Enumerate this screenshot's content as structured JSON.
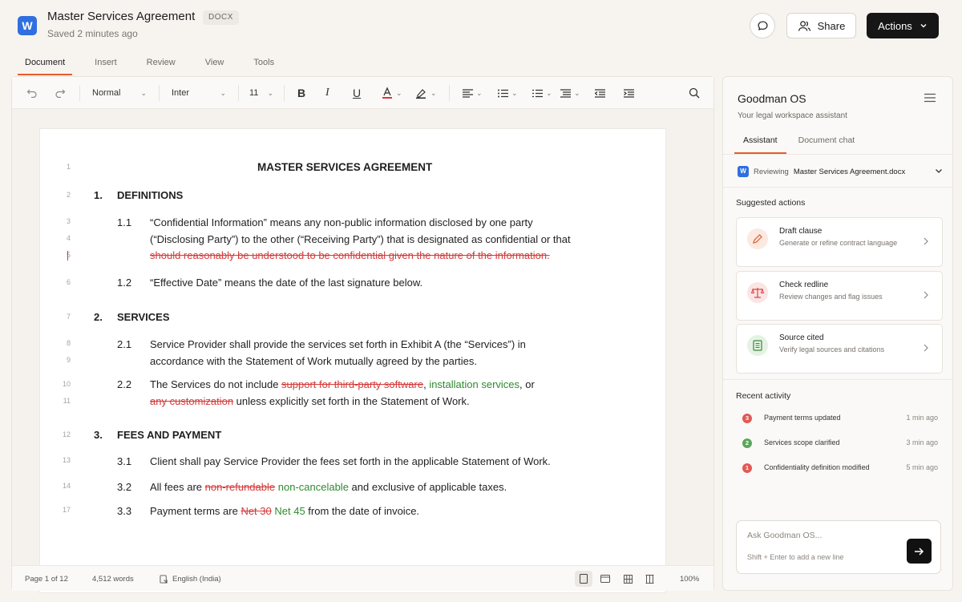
{
  "header": {
    "app_icon_letter": "W",
    "title": "Master Services Agreement",
    "badge": "DOCX",
    "saved": "Saved 2 minutes ago",
    "share_label": "Share",
    "actions_label": "Actions"
  },
  "menu": {
    "tabs": [
      "Document",
      "Insert",
      "Review",
      "View",
      "Tools"
    ]
  },
  "toolbar": {
    "style": "Normal",
    "font": "Inter",
    "size": "11"
  },
  "document": {
    "title": "MASTER SERVICES AGREEMENT",
    "line_numbers": [
      "1",
      "2",
      "3",
      "4",
      "5",
      "6",
      "7",
      "8",
      "9",
      "10",
      "11",
      "12",
      "13",
      "14",
      "17"
    ],
    "s1": {
      "num": "1.",
      "title": "DEFINITIONS"
    },
    "c11": {
      "num": "1.1",
      "l1": "“Confidential Information” means any non-public information disclosed by one party",
      "l2": "(“Disclosing Party”) to the other (“Receiving Party”) that is designated as confidential or that",
      "l3_del": "should reasonably be understood to be confidential given the nature of the information."
    },
    "c12": {
      "num": "1.2",
      "text": "“Effective Date” means the date of the last signature below."
    },
    "s2": {
      "num": "2.",
      "title": "SERVICES"
    },
    "c21": {
      "num": "2.1",
      "l1": "Service Provider shall provide the services set forth in Exhibit A (the “Services”) in",
      "l2": "accordance with the Statement of Work mutually agreed by the parties."
    },
    "c22": {
      "num": "2.2",
      "pre": "The Services do not include ",
      "del1": "support for third-party software",
      "comma": ", ",
      "ins1": "installation services",
      "post1": ", or",
      "del2": "any customization",
      "post2": " unless explicitly set forth in the Statement of Work."
    },
    "s3": {
      "num": "3.",
      "title": "FEES AND PAYMENT"
    },
    "c31": {
      "num": "3.1",
      "text": "Client shall pay Service Provider the fees set forth in the applicable Statement of Work."
    },
    "c32": {
      "num": "3.2",
      "pre": "All fees are ",
      "del": "non-refundable",
      "ins": "non-cancelable",
      "post": " and exclusive of applicable taxes."
    },
    "c33": {
      "num": "3.3",
      "pre": "Payment terms are ",
      "del": "Net 30",
      "ins": "Net 45",
      "post": " from the date of invoice."
    },
    "markers": [
      "1",
      "2",
      "3"
    ]
  },
  "status": {
    "page": "Page 1 of 12",
    "words": "4,512 words",
    "language": "English (India)",
    "zoom": "100%"
  },
  "panel": {
    "title": "Goodman OS",
    "subtitle": "Your legal workspace assistant",
    "tabs": [
      "Assistant",
      "Document chat"
    ],
    "reviewing_prefix": "Reviewing",
    "reviewing_doc": "Master Services Agreement.docx",
    "suggested_label": "Suggested actions",
    "actions": [
      {
        "title": "Draft clause",
        "desc": "Generate or refine contract language",
        "icon": "pencil-icon"
      },
      {
        "title": "Check redline",
        "desc": "Review changes and flag issues",
        "icon": "scale-icon"
      },
      {
        "title": "Source cited",
        "desc": "Verify legal sources and citations",
        "icon": "document-icon"
      }
    ],
    "recent_label": "Recent activity",
    "activity": [
      {
        "num": "3",
        "text": "Payment terms updated",
        "time": "1 min ago",
        "color": "#e05a55"
      },
      {
        "num": "2",
        "text": "Services scope clarified",
        "time": "3 min ago",
        "color": "#5aa75a"
      },
      {
        "num": "1",
        "text": "Confidentiality definition modified",
        "time": "5 min ago",
        "color": "#e05a55"
      }
    ],
    "ask_placeholder": "Ask Goodman OS...",
    "ask_hint": "Shift + Enter to add a new line"
  },
  "colors": {
    "accent": "#e45d2d",
    "deletion": "#d43a3a",
    "insertion": "#2e8b2e",
    "brand_blue": "#2f6fe0"
  }
}
